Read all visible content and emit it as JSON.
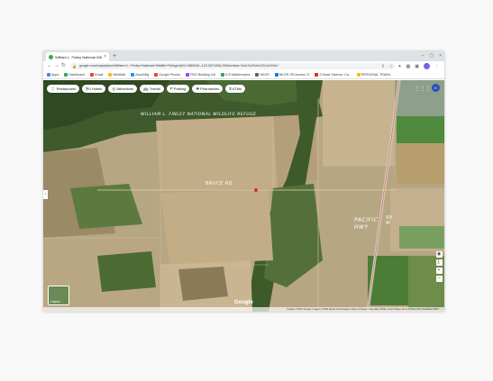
{
  "tab": {
    "title": "William L. Finley National Wildli",
    "close": "×"
  },
  "new_tab": "+",
  "window_controls": {
    "minimize": "–",
    "maximize": "▢",
    "close": "×"
  },
  "toolbar": {
    "back": "←",
    "forward": "→",
    "reload": "↻",
    "url": "google.com/maps/place/William+L.+Finley+National+Wildlife+Refuge/@44.3889491,-123.3071838,2906m/data=!3m1!1e3!4m10!1m2!2m1!",
    "profile_initial": "K"
  },
  "bookmarks": [
    {
      "label": "Apps",
      "color": "#4285f4"
    },
    {
      "label": "Dashboard",
      "color": "#34a853"
    },
    {
      "label": "Gmail",
      "color": "#ea4335"
    },
    {
      "label": "WebMail",
      "color": "#fbbc05"
    },
    {
      "label": "ZoomMtg",
      "color": "#2d8cff"
    },
    {
      "label": "Google Photos",
      "color": "#ea4335"
    },
    {
      "label": "PDG Building Cal",
      "color": "#a142f4"
    },
    {
      "label": "S.R Mathematics",
      "color": "#34a853"
    },
    {
      "label": "NKOR",
      "color": "#5f6368"
    },
    {
      "label": "NKOR OR Access Cl",
      "color": "#1a73e8"
    },
    {
      "label": "3 News Science, Ca...",
      "color": "#d93025"
    },
    {
      "label": "PERSONAL TRAINI...",
      "color": "#fbbc05"
    }
  ],
  "map": {
    "chips": [
      {
        "icon": "🍴",
        "label": "Restaurants"
      },
      {
        "icon": "🛏",
        "label": "Hotels"
      },
      {
        "icon": "◎",
        "label": "Attractions"
      },
      {
        "icon": "🚌",
        "label": "Transit"
      },
      {
        "icon": "P",
        "label": "Parking"
      },
      {
        "icon": "✚",
        "label": "Pharmacies"
      },
      {
        "icon": "$",
        "label": "ATMs"
      }
    ],
    "apps_icon": "⋮⋮⋮",
    "profile_initial": "K",
    "handwritten_labels": {
      "refuge": "WILLIAM L. FINLEY NATIONAL WILDLIFE REFUGE",
      "road": "BRUCE RD",
      "highway": "PACIFIC HWY",
      "highway_num": "99 W"
    },
    "layers_label": "Layers",
    "google_logo": "Google",
    "footer": "Imagery ©2021 Google, Imagery ©2021 Maxar Technologies, State of Oregon, Map data ©2021   United States   Terms   Privacy   Send feedback   500 ft",
    "side_expand": "‹",
    "controls": [
      "◉",
      "🚶",
      "+",
      "–"
    ]
  }
}
